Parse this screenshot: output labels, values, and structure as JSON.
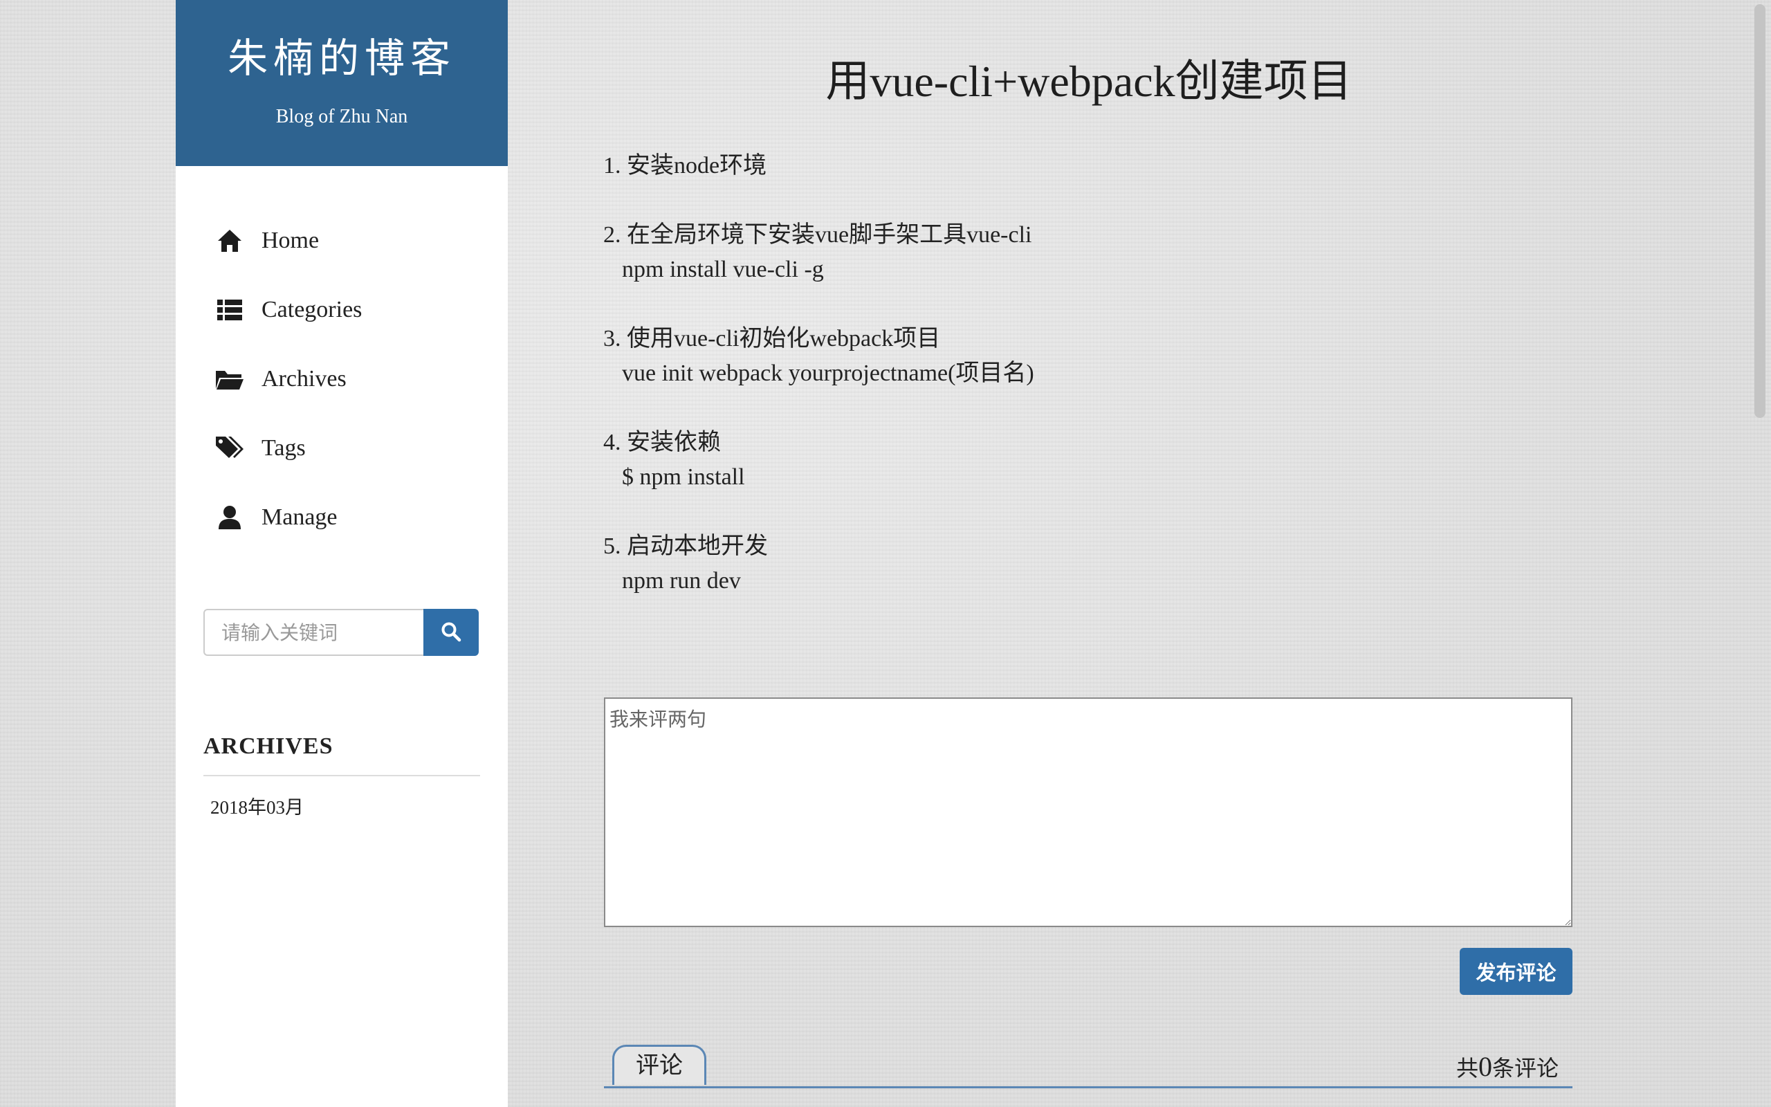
{
  "sidebar": {
    "blog_title": "朱楠的博客",
    "blog_subtitle": "Blog of Zhu Nan",
    "nav": [
      {
        "label": "Home",
        "icon": "home-icon"
      },
      {
        "label": "Categories",
        "icon": "list-icon"
      },
      {
        "label": "Archives",
        "icon": "folder-open-icon"
      },
      {
        "label": "Tags",
        "icon": "tags-icon"
      },
      {
        "label": "Manage",
        "icon": "user-icon"
      }
    ],
    "search": {
      "placeholder": "请输入关键词",
      "button_icon": "search-icon"
    },
    "archives": {
      "heading": "ARCHIVES",
      "items": [
        "2018年03月"
      ]
    }
  },
  "post": {
    "title": "用vue-cli+webpack创建项目",
    "steps": [
      {
        "text": "1. 安装node环境",
        "cmd": ""
      },
      {
        "text": "2. 在全局环境下安装vue脚手架工具vue-cli",
        "cmd": "npm install vue-cli -g"
      },
      {
        "text": "3. 使用vue-cli初始化webpack项目",
        "cmd": "vue init webpack yourprojectname(项目名)"
      },
      {
        "text": "4. 安装依赖",
        "cmd": "$ npm install"
      },
      {
        "text": "5. 启动本地开发",
        "cmd": "npm run dev"
      }
    ]
  },
  "comments": {
    "placeholder": "我来评两句",
    "submit_label": "发布评论",
    "tab_label": "评论",
    "count_prefix": "共",
    "count": "0",
    "count_suffix": "条评论"
  },
  "colors": {
    "brand": "#2e6390",
    "button": "#2f6ea8",
    "tab_border": "#5b87b5"
  }
}
